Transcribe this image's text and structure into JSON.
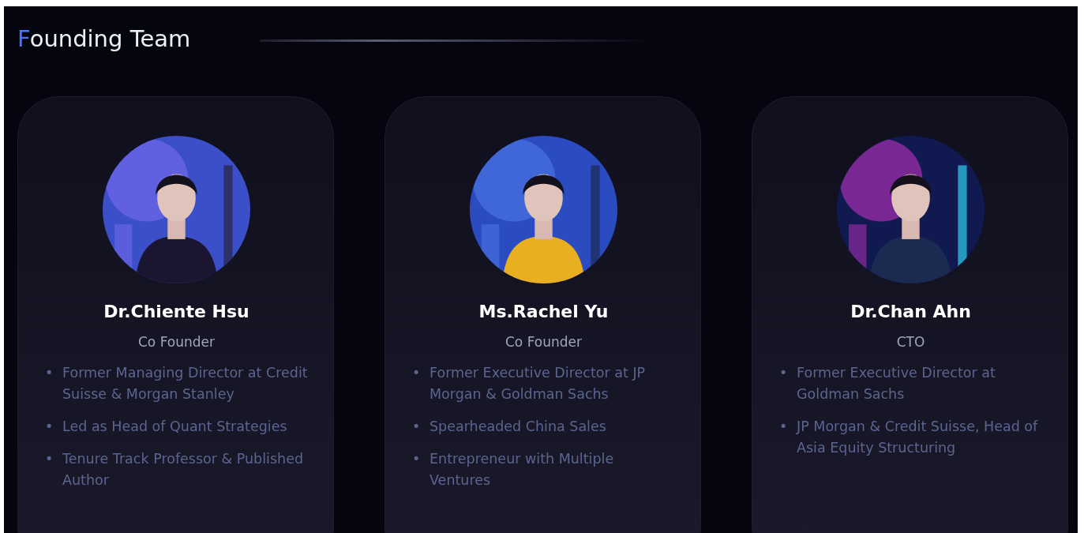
{
  "section": {
    "title": "Founding Team"
  },
  "members": [
    {
      "name": "Dr.Chiente Hsu",
      "role": "Co Founder",
      "points": [
        {
          "marker": "•",
          "text": "Former Managing Director at Credit Suisse & Morgan Stanley"
        },
        {
          "marker": "•",
          "text": "Led as Head of Quant Strategies"
        },
        {
          "marker": "•",
          "text": "Tenure Track Professor & Published Author"
        }
      ]
    },
    {
      "name": "Ms.Rachel Yu",
      "role": "Co Founder",
      "points": [
        {
          "marker": "•",
          "text": "Former Executive Director at JP Morgan & Goldman Sachs"
        },
        {
          "marker": "•",
          "text": "Spearheaded China Sales"
        },
        {
          "marker": "•",
          "text": "Entrepreneur with Multiple Ventures"
        }
      ]
    },
    {
      "name": "Dr.Chan Ahn",
      "role": "CTO",
      "points": [
        {
          "marker": "•",
          "text": "Former Executive Director at Goldman Sachs"
        },
        {
          "marker": "•",
          "text": "JP Morgan & Credit Suisse, Head of Asia Equity Structuring"
        }
      ]
    }
  ]
}
